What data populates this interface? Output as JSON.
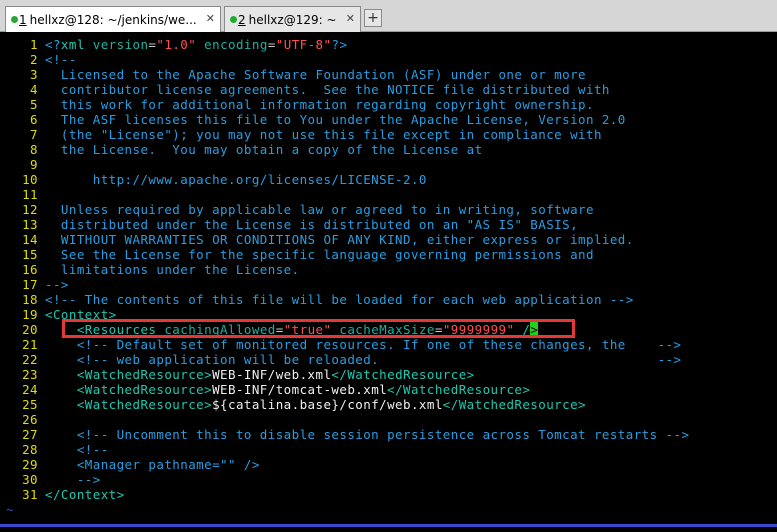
{
  "tabs": [
    {
      "number": "1",
      "title": "hellxz@128: ~/jenkins/we...",
      "close": "✕",
      "active": true
    },
    {
      "number": "2",
      "title": "hellxz@129: ~",
      "close": "✕",
      "active": false
    }
  ],
  "new_tab_label": "+",
  "lines": [
    {
      "n": "1",
      "parts": [
        [
          "comment",
          "<?"
        ],
        [
          "tag",
          "xml"
        ],
        [
          "attr",
          " version"
        ],
        [
          "eq",
          "="
        ],
        [
          "val",
          "\"1.0\""
        ],
        [
          "attr",
          " encoding"
        ],
        [
          "eq",
          "="
        ],
        [
          "val",
          "\"UTF-8\""
        ],
        [
          "comment",
          "?>"
        ]
      ]
    },
    {
      "n": "2",
      "parts": [
        [
          "comment",
          "<!--"
        ]
      ]
    },
    {
      "n": "3",
      "parts": [
        [
          "comment",
          "  Licensed to the Apache Software Foundation (ASF) under one or more"
        ]
      ]
    },
    {
      "n": "4",
      "parts": [
        [
          "comment",
          "  contributor license agreements.  See the NOTICE file distributed with"
        ]
      ]
    },
    {
      "n": "5",
      "parts": [
        [
          "comment",
          "  this work for additional information regarding copyright ownership."
        ]
      ]
    },
    {
      "n": "6",
      "parts": [
        [
          "comment",
          "  The ASF licenses this file to You under the Apache License, Version 2.0"
        ]
      ]
    },
    {
      "n": "7",
      "parts": [
        [
          "comment",
          "  (the \"License\"); you may not use this file except in compliance with"
        ]
      ]
    },
    {
      "n": "8",
      "parts": [
        [
          "comment",
          "  the License.  You may obtain a copy of the License at"
        ]
      ]
    },
    {
      "n": "9",
      "parts": []
    },
    {
      "n": "10",
      "parts": [
        [
          "comment",
          "      http://www.apache.org/licenses/LICENSE-2.0"
        ]
      ]
    },
    {
      "n": "11",
      "parts": []
    },
    {
      "n": "12",
      "parts": [
        [
          "comment",
          "  Unless required by applicable law or agreed to in writing, software"
        ]
      ]
    },
    {
      "n": "13",
      "parts": [
        [
          "comment",
          "  distributed under the License is distributed on an \"AS IS\" BASIS,"
        ]
      ]
    },
    {
      "n": "14",
      "parts": [
        [
          "comment",
          "  WITHOUT WARRANTIES OR CONDITIONS OF ANY KIND, either express or implied."
        ]
      ]
    },
    {
      "n": "15",
      "parts": [
        [
          "comment",
          "  See the License for the specific language governing permissions and"
        ]
      ]
    },
    {
      "n": "16",
      "parts": [
        [
          "comment",
          "  limitations under the License."
        ]
      ]
    },
    {
      "n": "17",
      "parts": [
        [
          "comment",
          "-->"
        ]
      ]
    },
    {
      "n": "18",
      "parts": [
        [
          "comment",
          "<!-- The contents of this file will be loaded for each web application -->"
        ]
      ]
    },
    {
      "n": "19",
      "parts": [
        [
          "tag",
          "<Context>"
        ]
      ]
    },
    {
      "n": "20",
      "parts": [
        [
          "text",
          "    "
        ],
        [
          "tag",
          "<Resources"
        ],
        [
          "attr",
          " cachingAllowed"
        ],
        [
          "eq",
          "="
        ],
        [
          "val",
          "\"true\""
        ],
        [
          "attr",
          " cacheMaxSize"
        ],
        [
          "eq",
          "="
        ],
        [
          "val",
          "\"9999999\""
        ],
        [
          "text",
          " "
        ],
        [
          "tag",
          "/"
        ],
        [
          "cursor",
          ">"
        ]
      ]
    },
    {
      "n": "21",
      "parts": [
        [
          "text",
          "    "
        ],
        [
          "comment",
          "<!-- Default set of monitored resources. If one of these changes, the    -->"
        ]
      ]
    },
    {
      "n": "22",
      "parts": [
        [
          "text",
          "    "
        ],
        [
          "comment",
          "<!-- web application will be reloaded.                                   -->"
        ]
      ]
    },
    {
      "n": "23",
      "parts": [
        [
          "text",
          "    "
        ],
        [
          "tag",
          "<WatchedResource>"
        ],
        [
          "text",
          "WEB-INF/web.xml"
        ],
        [
          "tag",
          "</WatchedResource>"
        ]
      ]
    },
    {
      "n": "24",
      "parts": [
        [
          "text",
          "    "
        ],
        [
          "tag",
          "<WatchedResource>"
        ],
        [
          "text",
          "WEB-INF/tomcat-web.xml"
        ],
        [
          "tag",
          "</WatchedResource>"
        ]
      ]
    },
    {
      "n": "25",
      "parts": [
        [
          "text",
          "    "
        ],
        [
          "tag",
          "<WatchedResource>"
        ],
        [
          "text",
          "${catalina.base}/conf/web.xml"
        ],
        [
          "tag",
          "</WatchedResource>"
        ]
      ]
    },
    {
      "n": "26",
      "parts": []
    },
    {
      "n": "27",
      "parts": [
        [
          "text",
          "    "
        ],
        [
          "comment",
          "<!-- Uncomment this to disable session persistence across Tomcat restarts -->"
        ]
      ]
    },
    {
      "n": "28",
      "parts": [
        [
          "text",
          "    "
        ],
        [
          "comment",
          "<!--"
        ]
      ]
    },
    {
      "n": "29",
      "parts": [
        [
          "text",
          "    "
        ],
        [
          "comment",
          "<Manager pathname=\"\" />"
        ]
      ]
    },
    {
      "n": "30",
      "parts": [
        [
          "text",
          "    "
        ],
        [
          "comment",
          "-->"
        ]
      ]
    },
    {
      "n": "31",
      "parts": [
        [
          "tag",
          "</Context>"
        ]
      ]
    }
  ],
  "empty_markers": [
    "~",
    "~"
  ]
}
